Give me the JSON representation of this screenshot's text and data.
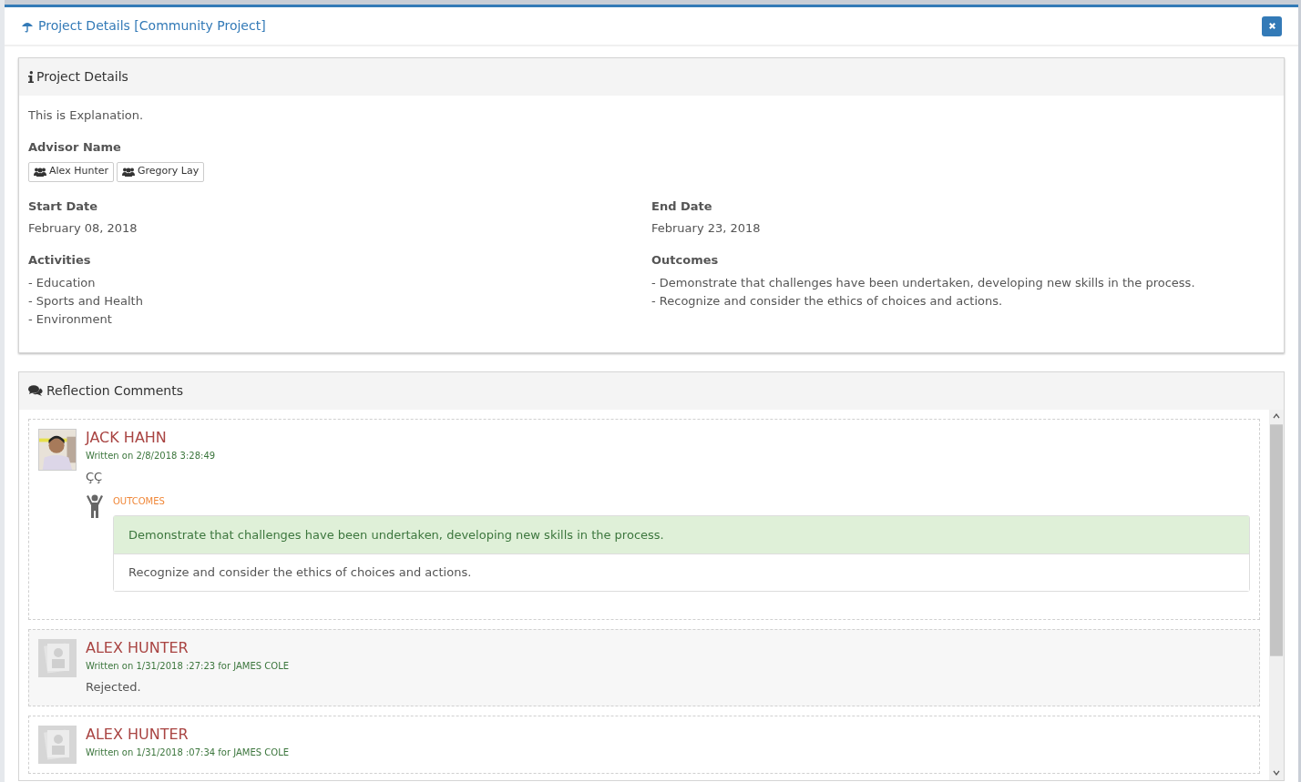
{
  "modal": {
    "title": "Project Details [Community Project]"
  },
  "details": {
    "heading": "Project Details",
    "explanation": "This is Explanation.",
    "advisor_label": "Advisor Name",
    "advisors": [
      "Alex Hunter",
      "Gregory Lay"
    ],
    "start_label": "Start Date",
    "start": "February 08, 2018",
    "end_label": "End Date",
    "end": "February 23, 2018",
    "activities_label": "Activities",
    "activities": [
      "- Education",
      "- Sports and Health",
      "- Environment"
    ],
    "outcomes_label": "Outcomes",
    "outcomes": [
      "- Demonstrate that challenges have been undertaken, developing new skills in the process.",
      "- Recognize and consider the ethics of choices and actions."
    ]
  },
  "comments": {
    "heading": "Reflection Comments",
    "items": [
      {
        "author": "JACK HAHN",
        "written": "Written on 2/8/2018 3:28:49",
        "text": "ÇÇ",
        "outcomes_label": "OUTCOMES",
        "outcomes": [
          {
            "text": "Demonstrate that challenges have been undertaken, developing new skills in the process.",
            "selected": true
          },
          {
            "text": "Recognize and consider the ethics of choices and actions.",
            "selected": false
          }
        ]
      },
      {
        "kind": "blank",
        "author": "ALEX HUNTER",
        "written": "Written on 1/31/2018 :27:23 for JAMES COLE",
        "text": "Rejected."
      },
      {
        "kind": "blank",
        "author": "ALEX HUNTER",
        "written": "Written on 1/31/2018 :07:34 for JAMES COLE"
      }
    ]
  }
}
